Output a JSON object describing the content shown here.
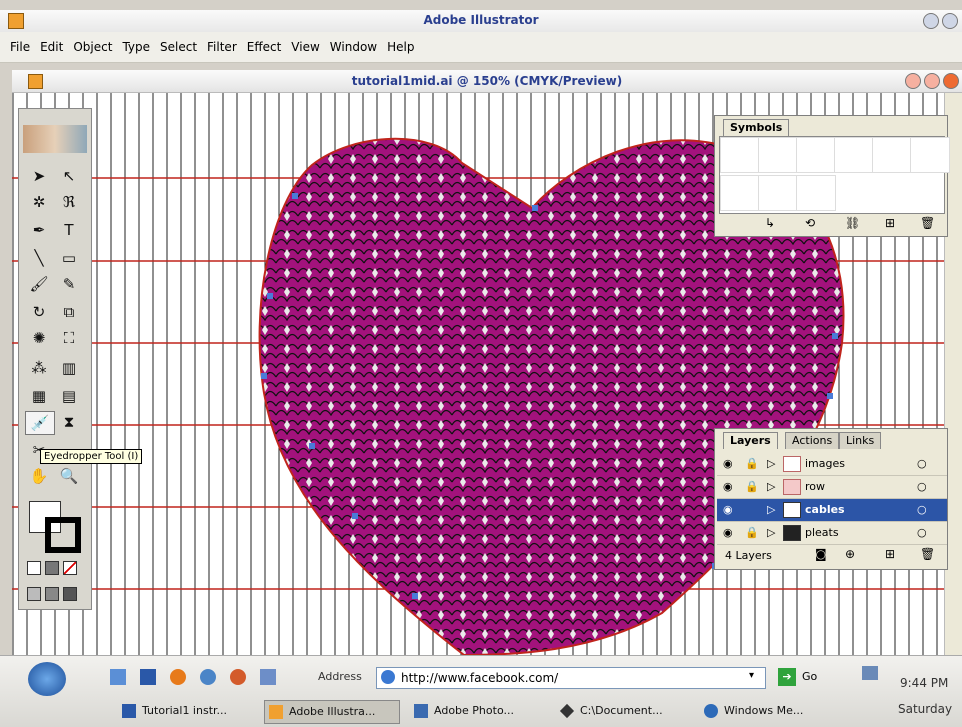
{
  "app": {
    "title": "Adobe Illustrator"
  },
  "menu": {
    "items": [
      "File",
      "Edit",
      "Object",
      "Type",
      "Select",
      "Filter",
      "Effect",
      "View",
      "Window",
      "Help"
    ]
  },
  "document": {
    "title": "tutorial1mid.ai @ 150% (CMYK/Preview)"
  },
  "tooltip": {
    "text": "Eyedropper Tool (I)"
  },
  "symbols_panel": {
    "tab": "Symbols"
  },
  "layers_panel": {
    "tabs": [
      "Layers",
      "Actions",
      "Links"
    ],
    "layers": [
      "images",
      "row",
      "cables",
      "pleats"
    ],
    "count": "4 Layers"
  },
  "taskbar": {
    "address_label": "Address",
    "address_value": "http://www.facebook.com/",
    "go_label": "Go",
    "time": "9:44 PM",
    "day": "Saturday",
    "tasks": [
      "Tutorial1 instr...",
      "Adobe Illustra...",
      "Adobe Photo...",
      "C:\\Document...",
      "Windows Me..."
    ]
  },
  "colors": {
    "accent": "#2c55a7",
    "heart_fill": "#a3127c",
    "guide_red": "#c0241c"
  },
  "icons": [
    "eye-icon",
    "lock-icon",
    "expand-triangle-icon",
    "ie-icon",
    "go-arrow-icon"
  ]
}
